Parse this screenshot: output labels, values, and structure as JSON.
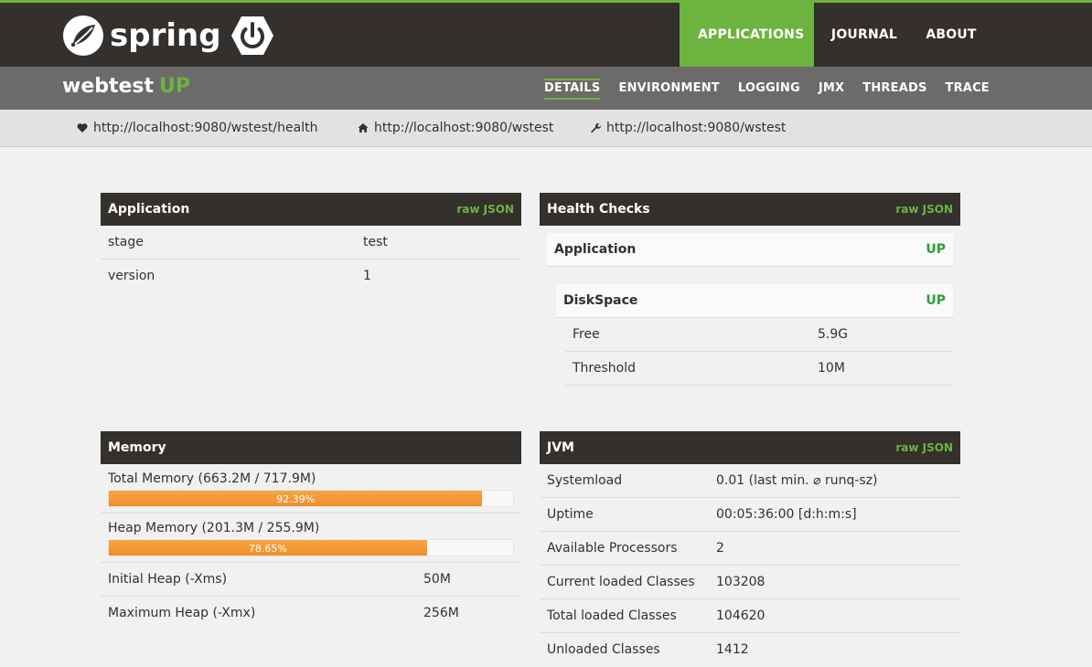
{
  "header": {
    "logo_text": "spring",
    "nav": [
      {
        "label": "APPLICATIONS",
        "active": true
      },
      {
        "label": "JOURNAL",
        "active": false
      },
      {
        "label": "ABOUT",
        "active": false
      }
    ]
  },
  "app": {
    "name": "webtest",
    "status": "UP",
    "tabs": [
      "DETAILS",
      "ENVIRONMENT",
      "LOGGING",
      "JMX",
      "THREADS",
      "TRACE"
    ],
    "active_tab": "DETAILS"
  },
  "urls": {
    "health": "http://localhost:9080/wstest/health",
    "home": "http://localhost:9080/wstest",
    "management": "http://localhost:9080/wstest"
  },
  "application_panel": {
    "title": "Application",
    "raw_label": "raw JSON",
    "rows": [
      {
        "key": "stage",
        "value": "test"
      },
      {
        "key": "version",
        "value": "1"
      }
    ]
  },
  "health_panel": {
    "title": "Health Checks",
    "raw_label": "raw JSON",
    "application": {
      "label": "Application",
      "status": "UP"
    },
    "diskspace": {
      "label": "DiskSpace",
      "status": "UP",
      "rows": [
        {
          "key": "Free",
          "value": "5.9G"
        },
        {
          "key": "Threshold",
          "value": "10M"
        }
      ]
    }
  },
  "memory_panel": {
    "title": "Memory",
    "total": {
      "label": "Total Memory (663.2M / 717.9M)",
      "percent_label": "92.39%",
      "percent": 92.39
    },
    "heap": {
      "label": "Heap Memory (201.3M / 255.9M)",
      "percent_label": "78.65%",
      "percent": 78.65
    },
    "rows": [
      {
        "key": "Initial Heap (-Xms)",
        "value": "50M"
      },
      {
        "key": "Maximum Heap (-Xmx)",
        "value": "256M"
      }
    ]
  },
  "jvm_panel": {
    "title": "JVM",
    "raw_label": "raw JSON",
    "rows": [
      {
        "key": "Systemload",
        "value": "0.01 (last min. ⌀ runq-sz)"
      },
      {
        "key": "Uptime",
        "value": "00:05:36:00 [d:h:m:s]"
      },
      {
        "key": "Available Processors",
        "value": "2"
      },
      {
        "key": "Current loaded Classes",
        "value": "103208"
      },
      {
        "key": "Total loaded Classes",
        "value": "104620"
      },
      {
        "key": "Unloaded Classes",
        "value": "1412"
      }
    ]
  },
  "colors": {
    "brand_green": "#6db33f",
    "dark": "#34302d",
    "status_up": "#2e9e3a",
    "bar_orange": "#f59a3a"
  }
}
